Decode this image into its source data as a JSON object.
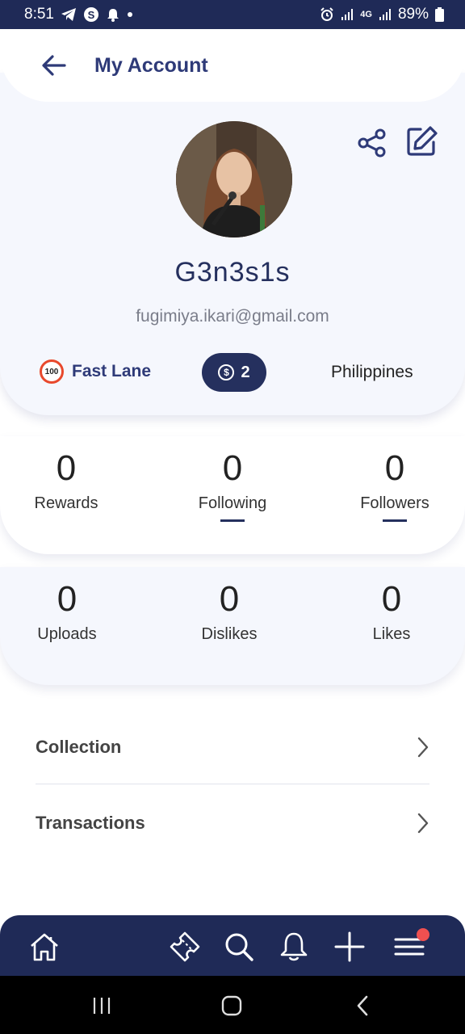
{
  "status_bar": {
    "time": "8:51",
    "battery": "89%",
    "network": "4G",
    "icons": [
      "telegram-icon",
      "s-app-icon",
      "bell-icon",
      "dot-icon",
      "alarm-icon",
      "signal-icon",
      "data-icon",
      "signal-icon",
      "battery-icon"
    ]
  },
  "header": {
    "title": "My Account",
    "back_icon": "arrow-left-icon"
  },
  "profile": {
    "username": "G3n3s1s",
    "email": "fugimiya.ikari@gmail.com",
    "badge_icon_text": "100",
    "badge_label": "Fast Lane",
    "coins": "2",
    "country": "Philippines",
    "actions": [
      "share-icon",
      "edit-icon"
    ]
  },
  "stats_row1": [
    {
      "value": "0",
      "label": "Rewards"
    },
    {
      "value": "0",
      "label": "Following"
    },
    {
      "value": "0",
      "label": "Followers"
    }
  ],
  "stats_row2": [
    {
      "value": "0",
      "label": "Uploads"
    },
    {
      "value": "0",
      "label": "Dislikes"
    },
    {
      "value": "0",
      "label": "Likes"
    }
  ],
  "menu": [
    {
      "label": "Collection"
    },
    {
      "label": "Transactions"
    }
  ],
  "bottom_nav": [
    "home-icon",
    "ticket-icon",
    "search-icon",
    "bell-icon",
    "plus-icon",
    "menu-icon"
  ],
  "colors": {
    "primary": "#1f2a57",
    "accent_title": "#2e3a78",
    "card_bg": "#f5f7fd",
    "notification_dot": "#ef5050",
    "badge_ring": "#e8482c"
  }
}
